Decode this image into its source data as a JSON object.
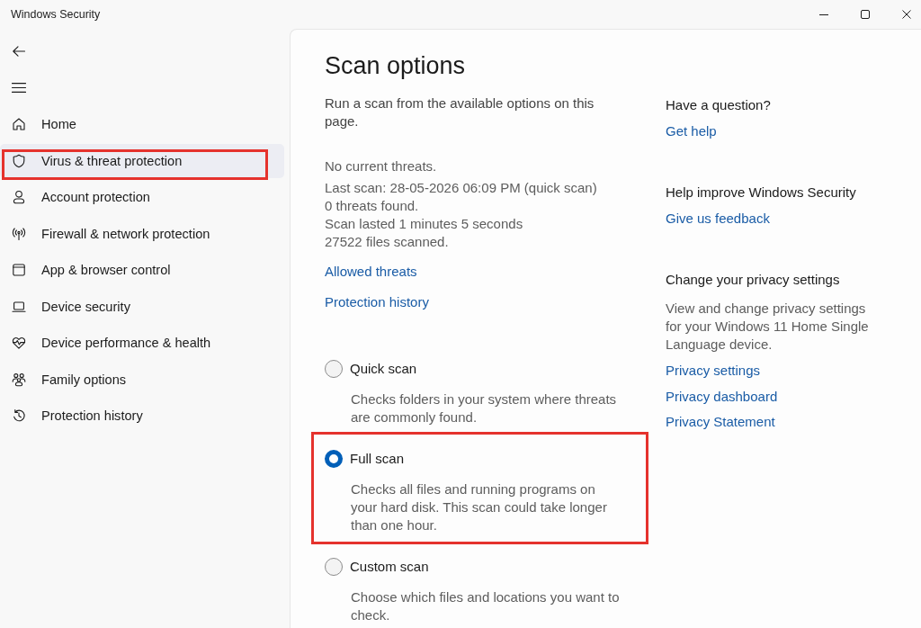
{
  "window": {
    "title": "Windows Security"
  },
  "sidebar": {
    "items": [
      {
        "label": "Home",
        "selected": false,
        "highlighted": false
      },
      {
        "label": "Virus & threat protection",
        "selected": true,
        "highlighted": true
      },
      {
        "label": "Account protection",
        "selected": false,
        "highlighted": false
      },
      {
        "label": "Firewall & network protection",
        "selected": false,
        "highlighted": false
      },
      {
        "label": "App & browser control",
        "selected": false,
        "highlighted": false
      },
      {
        "label": "Device security",
        "selected": false,
        "highlighted": false
      },
      {
        "label": "Device performance & health",
        "selected": false,
        "highlighted": false
      },
      {
        "label": "Family options",
        "selected": false,
        "highlighted": false
      },
      {
        "label": "Protection history",
        "selected": false,
        "highlighted": false
      }
    ]
  },
  "page": {
    "title": "Scan options",
    "description": "Run a scan from the available options on this page.",
    "status": {
      "summary": "No current threats.",
      "details": [
        "Last scan: 28-05-2026 06:09 PM (quick scan)",
        "0 threats found.",
        "Scan lasted 1 minutes 5 seconds",
        "27522 files scanned."
      ]
    },
    "links": [
      "Allowed threats",
      "Protection history"
    ],
    "scan_options": [
      {
        "label": "Quick scan",
        "description": "Checks folders in your system where threats are commonly found.",
        "selected": false,
        "highlighted": false
      },
      {
        "label": "Full scan",
        "description": "Checks all files and running programs on your hard disk. This scan could take longer than one hour.",
        "selected": true,
        "highlighted": true
      },
      {
        "label": "Custom scan",
        "description": "Choose which files and locations you want to check.",
        "selected": false,
        "highlighted": false
      }
    ]
  },
  "side_panel": {
    "sections": [
      {
        "heading": "Have a question?",
        "links": [
          "Get help"
        ]
      },
      {
        "heading": "Help improve Windows Security",
        "links": [
          "Give us feedback"
        ]
      },
      {
        "heading": "Change your privacy settings",
        "text": "View and change privacy settings for your Windows 11 Home Single Language device.",
        "links": [
          "Privacy settings",
          "Privacy dashboard",
          "Privacy Statement"
        ]
      }
    ]
  }
}
